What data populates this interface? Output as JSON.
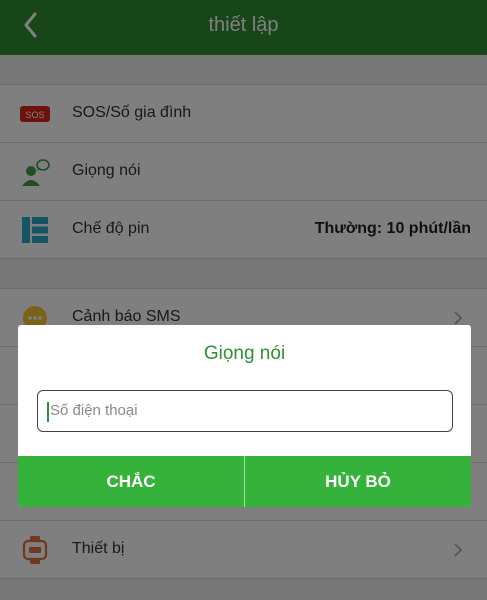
{
  "header": {
    "title": "thiết lập"
  },
  "rows": [
    {
      "label": "SOS/Số gia đình",
      "icon": "sos-icon",
      "badge": "SOS"
    },
    {
      "label": "Giọng nói",
      "icon": "voice-icon"
    },
    {
      "label": "Chế độ pin",
      "icon": "battery-mode-icon",
      "value": "Thường: 10 phút/lần"
    },
    {
      "label": "Cảnh báo SMS",
      "icon": "sms-alert-icon"
    },
    {
      "label": "Thiết bị",
      "icon": "device-watch-icon"
    }
  ],
  "dialog": {
    "title": "Giọng nói",
    "input_placeholder": "Số điện thoại",
    "input_value": "",
    "confirm_label": "CHẮC",
    "cancel_label": "HỦY BỎ"
  },
  "colors": {
    "accent": "#2f8f32",
    "button": "#35b23a",
    "sos_red": "#d9261c"
  }
}
